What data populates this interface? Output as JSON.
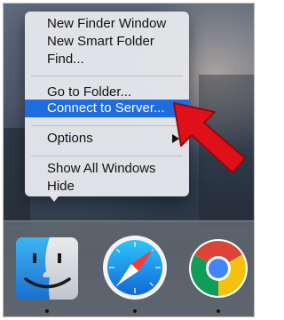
{
  "context_menu": {
    "items": [
      {
        "label": "New Finder Window"
      },
      {
        "label": "New Smart Folder"
      },
      {
        "label": "Find..."
      },
      {
        "label": "Go to Folder..."
      },
      {
        "label": "Connect to Server...",
        "selected": true
      },
      {
        "label": "Options",
        "has_submenu": true
      },
      {
        "label": "Show All Windows"
      },
      {
        "label": "Hide"
      }
    ]
  },
  "dock": {
    "apps": [
      {
        "name": "finder",
        "icon": "finder-icon",
        "running": true
      },
      {
        "name": "safari",
        "icon": "safari-icon",
        "running": true
      },
      {
        "name": "chrome",
        "icon": "chrome-icon",
        "running": true
      }
    ]
  },
  "annotation": {
    "icon": "red-arrow-icon",
    "color": "#e0101b"
  },
  "colors": {
    "selection": "#1f6be0",
    "menu_bg": "#e4e6ea"
  }
}
